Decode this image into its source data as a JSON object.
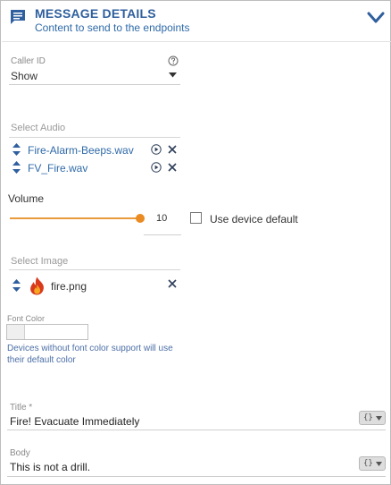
{
  "header": {
    "title": "MESSAGE DETAILS",
    "subtitle": "Content to send to the endpoints",
    "icon": "message-icon",
    "toggle_icon": "chevron-down-icon"
  },
  "caller_id": {
    "label": "Caller ID",
    "value": "Show",
    "help_icon": "help-icon"
  },
  "audio": {
    "placeholder": "Select Audio",
    "items": [
      {
        "name": "Fire-Alarm-Beeps.wav"
      },
      {
        "name": "FV_Fire.wav"
      }
    ]
  },
  "volume": {
    "label": "Volume",
    "value": "10",
    "level": 1.0,
    "checkbox_label": "Use device default",
    "checkbox_checked": false
  },
  "image": {
    "placeholder": "Select Image",
    "items": [
      {
        "name": "fire.png",
        "icon": "fire-icon"
      }
    ]
  },
  "font_color": {
    "label": "Font Color",
    "help": "Devices without font color support will use their default color"
  },
  "title_field": {
    "label": "Title *",
    "value": "Fire! Evacuate Immediately",
    "var_button": "{}"
  },
  "body_field": {
    "label": "Body",
    "value": "This is not a drill.",
    "var_button": "{}"
  },
  "colors": {
    "accent_blue": "#2f5f9e",
    "slider_orange": "#e98b22",
    "fire_red": "#d93a1c"
  }
}
